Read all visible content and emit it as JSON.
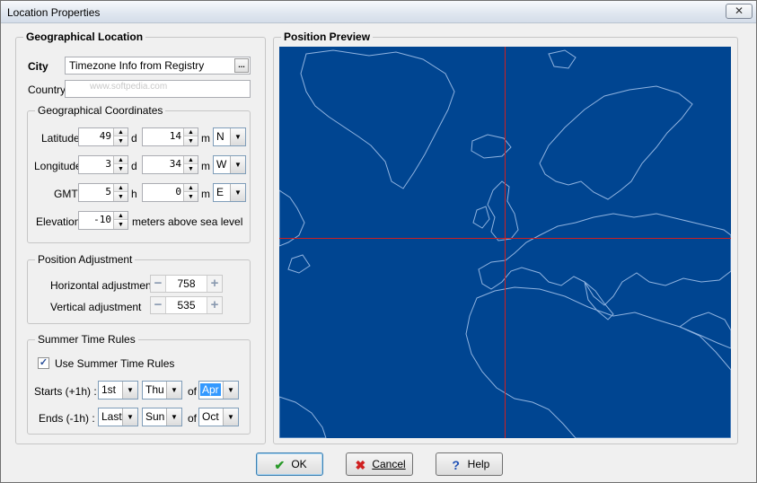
{
  "window": {
    "title": "Location Properties",
    "close_symbol": "✕"
  },
  "geo": {
    "heading": "Geographical Location",
    "city_label": "City",
    "city_value": "Timezone Info from Registry",
    "city_button": "...",
    "country_label": "Country",
    "country_value": "",
    "watermark": "www.softpedia.com",
    "coords": {
      "heading": "Geographical Coordinates",
      "latitude_label": "Latitude",
      "latitude_deg": "49",
      "latitude_min": "14",
      "latitude_dir": "N",
      "longitude_label": "Longitude",
      "longitude_deg": "3",
      "longitude_min": "34",
      "longitude_dir": "W",
      "gmt_label": "GMT",
      "gmt_h": "5",
      "gmt_min": "0",
      "gmt_dir": "E",
      "unit_d": "d",
      "unit_m": "m",
      "unit_h": "h",
      "elevation_label": "Elevation",
      "elevation_value": "-10",
      "elevation_unit": "meters above sea level"
    },
    "adjust": {
      "heading": "Position Adjustment",
      "horizontal_label": "Horizontal adjustment",
      "horizontal_value": "758",
      "vertical_label": "Vertical adjustment",
      "vertical_value": "535",
      "minus": "−",
      "plus": "+"
    },
    "summer": {
      "heading": "Summer Time Rules",
      "use_label": "Use Summer Time Rules",
      "use_checked": true,
      "check_mark": "✓",
      "starts_label": "Starts (+1h) :",
      "starts_week": "1st",
      "starts_day": "Thu",
      "starts_month": "Apr",
      "ends_label": "Ends (-1h) :",
      "ends_week": "Last",
      "ends_day": "Sun",
      "ends_month": "Oct",
      "of_label": "of"
    }
  },
  "preview": {
    "heading": "Position Preview",
    "sea_color": "#004591",
    "coast_color": "#8fb3e0",
    "crosshair_color": "#d02020",
    "crosshair_fraction_x": 0.4985,
    "crosshair_fraction_y": 0.4885
  },
  "buttons": {
    "ok": "OK",
    "ok_icon": "✔",
    "cancel": "Cancel",
    "cancel_icon": "✖",
    "help": "Help",
    "help_icon": "?"
  },
  "icons": {
    "dropdown_arrow": "▼",
    "spin_up": "▲",
    "spin_down": "▼"
  }
}
